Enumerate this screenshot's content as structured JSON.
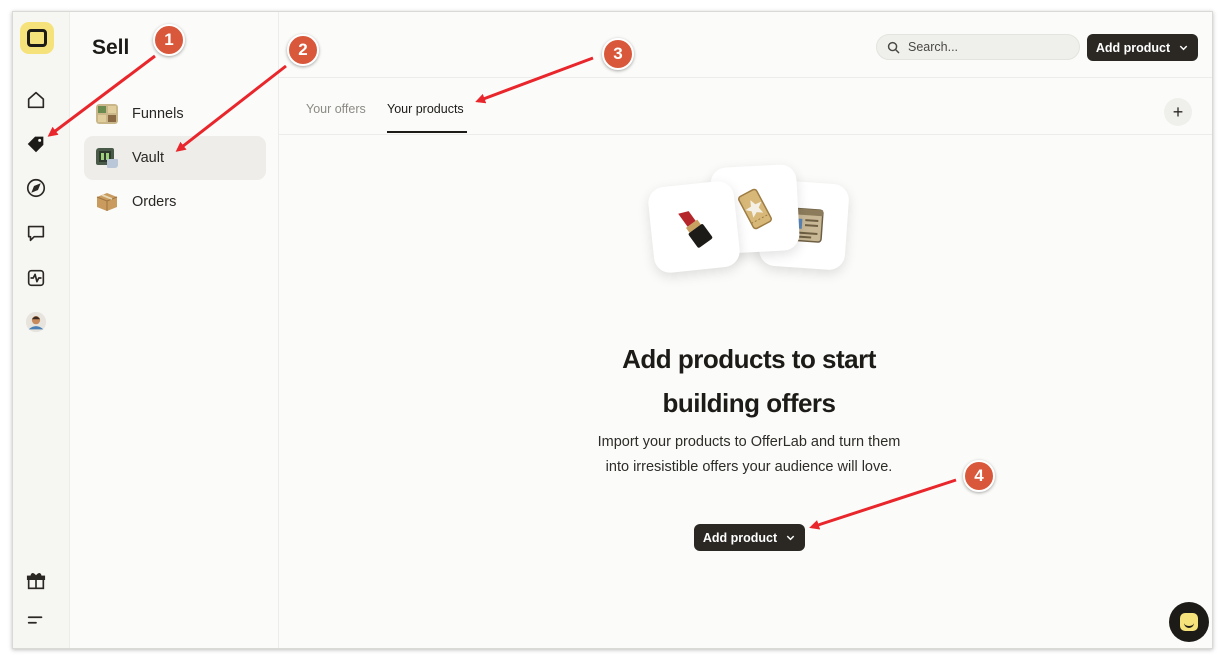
{
  "page": {
    "title": "Sell"
  },
  "rail": {
    "items": [
      {
        "name": "home-icon"
      },
      {
        "name": "tag-icon",
        "active": true
      },
      {
        "name": "compass-icon"
      },
      {
        "name": "chat-icon"
      },
      {
        "name": "activity-icon"
      },
      {
        "name": "avatar"
      },
      {
        "name": "gift-icon"
      },
      {
        "name": "menu-icon"
      }
    ]
  },
  "sidebar": {
    "items": [
      {
        "label": "Funnels",
        "icon": "funnels-icon"
      },
      {
        "label": "Vault",
        "icon": "vault-icon",
        "active": true
      },
      {
        "label": "Orders",
        "icon": "box-icon"
      }
    ]
  },
  "header": {
    "search_placeholder": "Search...",
    "add_button_label": "Add product"
  },
  "tabs": [
    {
      "label": "Your offers",
      "active": false
    },
    {
      "label": "Your products",
      "active": true
    }
  ],
  "empty_state": {
    "headline_line1": "Add products to start",
    "headline_line2": "building offers",
    "description": "Import your products to OfferLab and turn them into irresistible offers your audience will love.",
    "button_label": "Add product",
    "illustrations": [
      "lipstick-icon",
      "ticket-icon",
      "browser-icon"
    ]
  },
  "annotations": [
    "1",
    "2",
    "3",
    "4"
  ],
  "colors": {
    "accent_dark": "#2b2824",
    "brand_yellow": "#f6e27a",
    "annotation_red": "#d9573a",
    "arrow_red": "#e8262b"
  }
}
